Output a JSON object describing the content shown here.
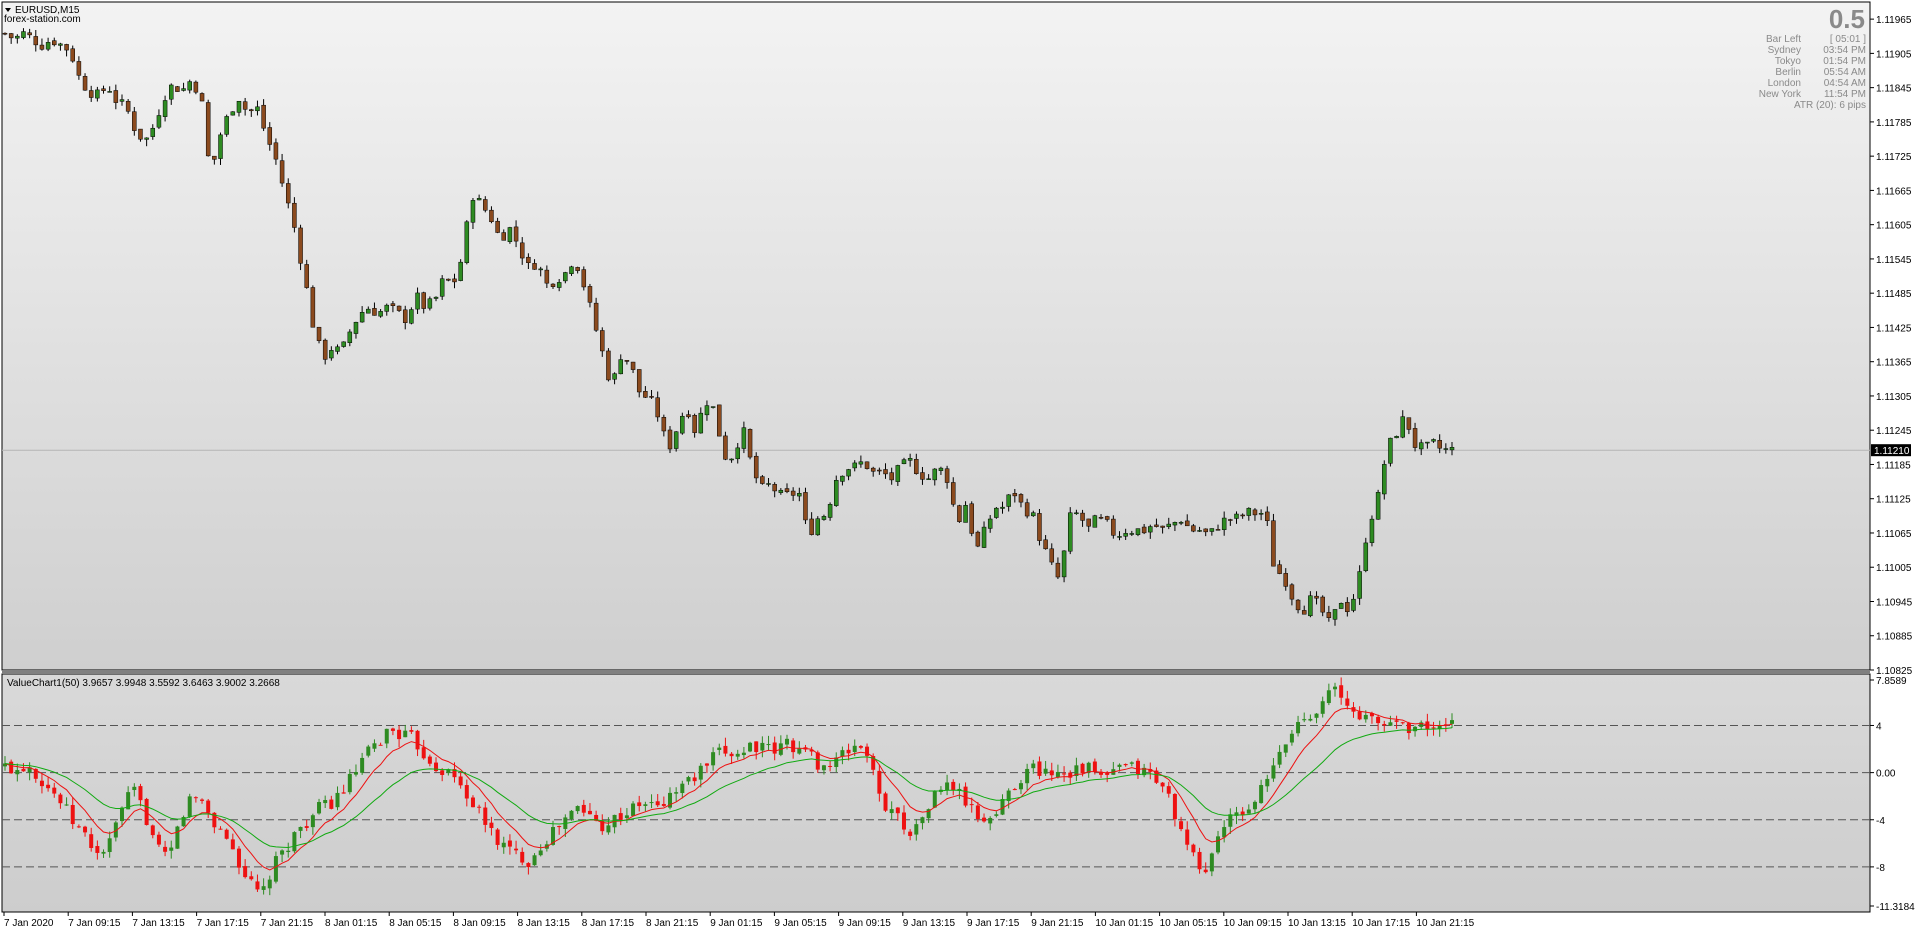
{
  "window": {
    "symbol_title": "EURUSD,M15",
    "watermark": "forex-station.com"
  },
  "info_panel": {
    "spread": "0.5",
    "rows": [
      {
        "label": "Bar Left",
        "value": "[ 05:01 ]"
      },
      {
        "label": "Sydney",
        "value": "03:54 PM"
      },
      {
        "label": "Tokyo",
        "value": "01:54 PM"
      },
      {
        "label": "Berlin",
        "value": "05:54 AM"
      },
      {
        "label": "London",
        "value": "04:54 AM"
      },
      {
        "label": "New York",
        "value": "11:54 PM"
      }
    ],
    "atr": "ATR (20): 6 pips"
  },
  "indicator": {
    "title": "ValueChart1(50) 3.9657 3.9948 3.5592 3.6463 3.9002 3.2668"
  },
  "colors": {
    "bull": "#2e8b22",
    "bear": "#8b4a1e",
    "vc_up": "#2e8b22",
    "vc_down": "#ee1111",
    "ma_fast": "#ee1111",
    "ma_slow": "#11aa11",
    "current_price_bg": "#000000"
  },
  "chart_data": [
    {
      "type": "candlestick",
      "symbol": "EURUSD",
      "timeframe": "M15",
      "y_ticks": [
        "1.11965",
        "1.11905",
        "1.11845",
        "1.11785",
        "1.11725",
        "1.11665",
        "1.11605",
        "1.11545",
        "1.11485",
        "1.11425",
        "1.11365",
        "1.11305",
        "1.11245",
        "1.11185",
        "1.11125",
        "1.11065",
        "1.11005",
        "1.10945",
        "1.10885",
        "1.10825"
      ],
      "ylim": [
        1.10825,
        1.11995
      ],
      "current_price": "1.11210",
      "x_tick_labels": [
        "7 Jan 2020",
        "7 Jan 09:15",
        "7 Jan 13:15",
        "7 Jan 17:15",
        "7 Jan 21:15",
        "8 Jan 01:15",
        "8 Jan 05:15",
        "8 Jan 09:15",
        "8 Jan 13:15",
        "8 Jan 17:15",
        "8 Jan 21:15",
        "9 Jan 01:15",
        "9 Jan 05:15",
        "9 Jan 09:15",
        "9 Jan 13:15",
        "9 Jan 17:15",
        "9 Jan 21:15",
        "10 Jan 01:15",
        "10 Jan 05:15",
        "10 Jan 09:15",
        "10 Jan 13:15",
        "10 Jan 17:15",
        "10 Jan 21:15"
      ],
      "close_path": [
        1.1194,
        1.1193,
        1.1194,
        1.1193,
        1.1192,
        1.1193,
        1.1192,
        1.1191,
        1.1186,
        1.1184,
        1.1183,
        1.1185,
        1.1182,
        1.1181,
        1.1177,
        1.1175,
        1.1178,
        1.1183,
        1.1185,
        1.1184,
        1.1186,
        1.1183,
        1.1169,
        1.1176,
        1.118,
        1.1183,
        1.118,
        1.1181,
        1.1176,
        1.1172,
        1.1166,
        1.116,
        1.1152,
        1.1143,
        1.1137,
        1.1139,
        1.1138,
        1.1142,
        1.1145,
        1.1146,
        1.1145,
        1.1146,
        1.1145,
        1.1144,
        1.1148,
        1.1146,
        1.1147,
        1.1151,
        1.115,
        1.1155,
        1.1166,
        1.1164,
        1.1162,
        1.1158,
        1.116,
        1.1157,
        1.1153,
        1.1154,
        1.115,
        1.1151,
        1.1152,
        1.1155,
        1.115,
        1.1144,
        1.1138,
        1.1132,
        1.1138,
        1.1136,
        1.1131,
        1.113,
        1.1127,
        1.1121,
        1.1125,
        1.1129,
        1.1124,
        1.113,
        1.1128,
        1.112,
        1.112,
        1.1125,
        1.1118,
        1.1114,
        1.1115,
        1.1113,
        1.1113,
        1.1114,
        1.1106,
        1.1109,
        1.111,
        1.1116,
        1.1118,
        1.1118,
        1.1119,
        1.1117,
        1.1117,
        1.1116,
        1.1118,
        1.1119,
        1.1117,
        1.1116,
        1.1118,
        1.1116,
        1.1108,
        1.1112,
        1.1103,
        1.1107,
        1.1111,
        1.1111,
        1.1114,
        1.1111,
        1.111,
        1.1105,
        1.1101,
        1.1098,
        1.1109,
        1.111,
        1.1107,
        1.1109,
        1.1108,
        1.1106,
        1.1107,
        1.1107,
        1.1107,
        1.1108,
        1.1107,
        1.1108,
        1.1109,
        1.1107,
        1.1107,
        1.1106,
        1.1108,
        1.1109,
        1.1109,
        1.111,
        1.111,
        1.111,
        1.11,
        1.1099,
        1.1095,
        1.1093,
        1.1095,
        1.1093,
        1.109,
        1.1095,
        1.1093,
        1.1098,
        1.1108,
        1.1112,
        1.1121,
        1.1124,
        1.1127,
        1.1122,
        1.1121,
        1.1122,
        1.1121,
        1.1121
      ]
    },
    {
      "type": "line",
      "name": "ValueChart1(50)",
      "y_ticks": [
        "7.8589",
        "4",
        "0.00",
        "-4",
        "-8",
        "-11.3184"
      ],
      "levels": [
        4,
        0,
        -4,
        -8
      ],
      "ylim": [
        -11.3184,
        7.8589
      ],
      "value_path": [
        0.5,
        0.3,
        0.8,
        -0.5,
        -1.5,
        -2.8,
        -4.5,
        -5.5,
        -7.0,
        -6.0,
        -3.0,
        -1.5,
        -3.5,
        -6.5,
        -7.5,
        -4.0,
        -2.0,
        -2.5,
        -4.5,
        -5.5,
        -7.5,
        -9.5,
        -10.5,
        -8.0,
        -6.5,
        -5.0,
        -4.0,
        -3.0,
        -2.5,
        -1.5,
        0.0,
        1.5,
        2.5,
        3.8,
        3.2,
        2.8,
        1.5,
        0.5,
        0.0,
        -1.0,
        -2.5,
        -4.0,
        -5.5,
        -6.5,
        -7.0,
        -7.5,
        -6.0,
        -5.0,
        -4.0,
        -3.0,
        -3.5,
        -4.5,
        -4.0,
        -3.5,
        -3.0,
        -2.5,
        -3.0,
        -2.0,
        -1.0,
        -0.5,
        0.5,
        1.5,
        1.8,
        1.6,
        2.5,
        2.0,
        1.8,
        2.6,
        2.0,
        1.5,
        0.5,
        0.8,
        1.6,
        2.5,
        1.5,
        -2.5,
        -3.0,
        -4.5,
        -5.0,
        -3.0,
        -1.5,
        -1.0,
        -2.0,
        -3.5,
        -4.0,
        -3.5,
        -1.5,
        -0.5,
        0.5,
        0.0,
        0.2,
        0.0,
        0.5,
        0.3,
        -0.5,
        0.0,
        0.5,
        0.3,
        0.0,
        -1.0,
        -2.5,
        -6.0,
        -7.5,
        -8.5,
        -5.0,
        -4.0,
        -3.5,
        -2.5,
        -1.0,
        1.0,
        3.0,
        4.5,
        5.0,
        6.5,
        7.0,
        5.5,
        5.0,
        4.5,
        4.0,
        4.5,
        4.0,
        3.8,
        4.0,
        3.6,
        3.9
      ]
    }
  ]
}
